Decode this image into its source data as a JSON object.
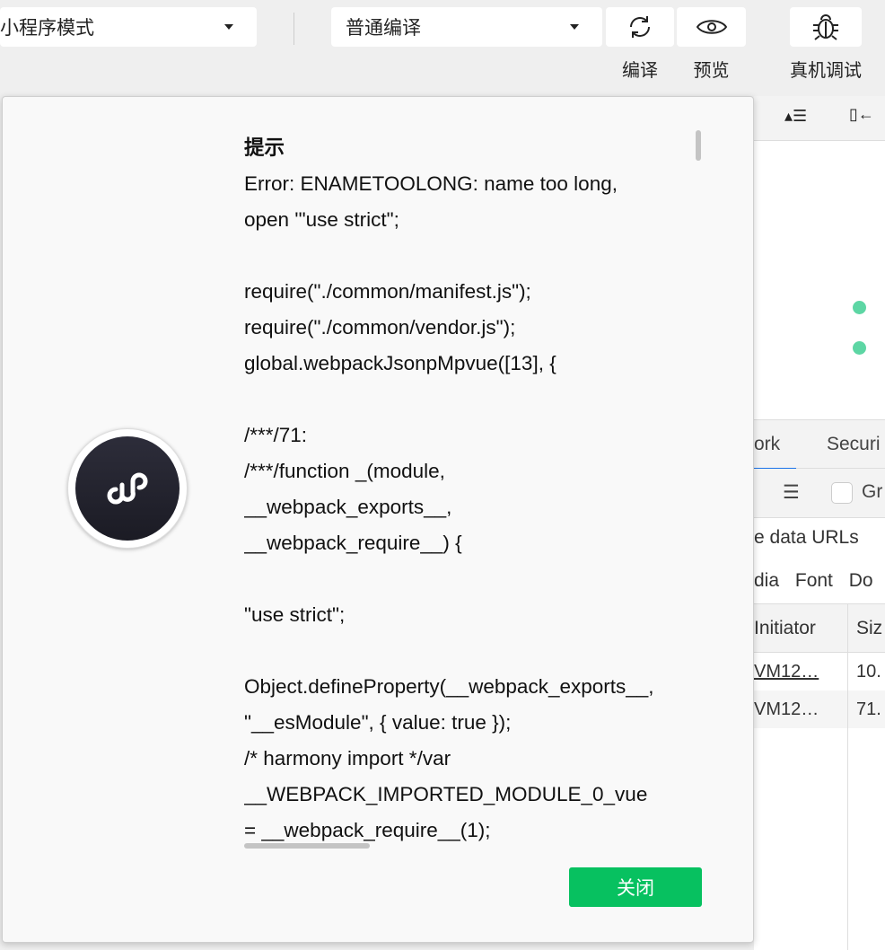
{
  "toolbar": {
    "mode_select": "小程序模式",
    "compile_select": "普通编译",
    "buttons": [
      {
        "label": "编译",
        "icon": "refresh-icon"
      },
      {
        "label": "预览",
        "icon": "eye-icon"
      },
      {
        "label": "真机调试",
        "icon": "bug-icon"
      }
    ]
  },
  "devtools": {
    "tabs": [
      "ork",
      "Securi"
    ],
    "group_checkbox": "Gr",
    "hide_data_urls": "e data URLs",
    "filters": [
      "dia",
      "Font",
      "Do"
    ],
    "columns": [
      "Initiator",
      "Siz"
    ],
    "rows": [
      {
        "initiator": "VM12…",
        "size": "10."
      },
      {
        "initiator": "VM12…",
        "size": "71."
      }
    ],
    "status_color": "#5dd6a4"
  },
  "dialog": {
    "title": "提示",
    "lines": [
      "Error: ENAMETOOLONG: name too long,",
      "open '\"use strict\";",
      "",
      "require(\"./common/manifest.js\");",
      "require(\"./common/vendor.js\");",
      "global.webpackJsonpMpvue([13], {",
      "",
      "/***/71:",
      "/***/function _(module,",
      "__webpack_exports__,",
      "__webpack_require__) {",
      "",
      "\"use strict\";",
      "",
      "Object.defineProperty(__webpack_exports__,",
      "\"__esModule\", { value: true });",
      "/* harmony import */var",
      "__WEBPACK_IMPORTED_MODULE_0_vue",
      "= __webpack_require__(1);"
    ],
    "close_label": "关闭",
    "accent": "#07c160"
  }
}
